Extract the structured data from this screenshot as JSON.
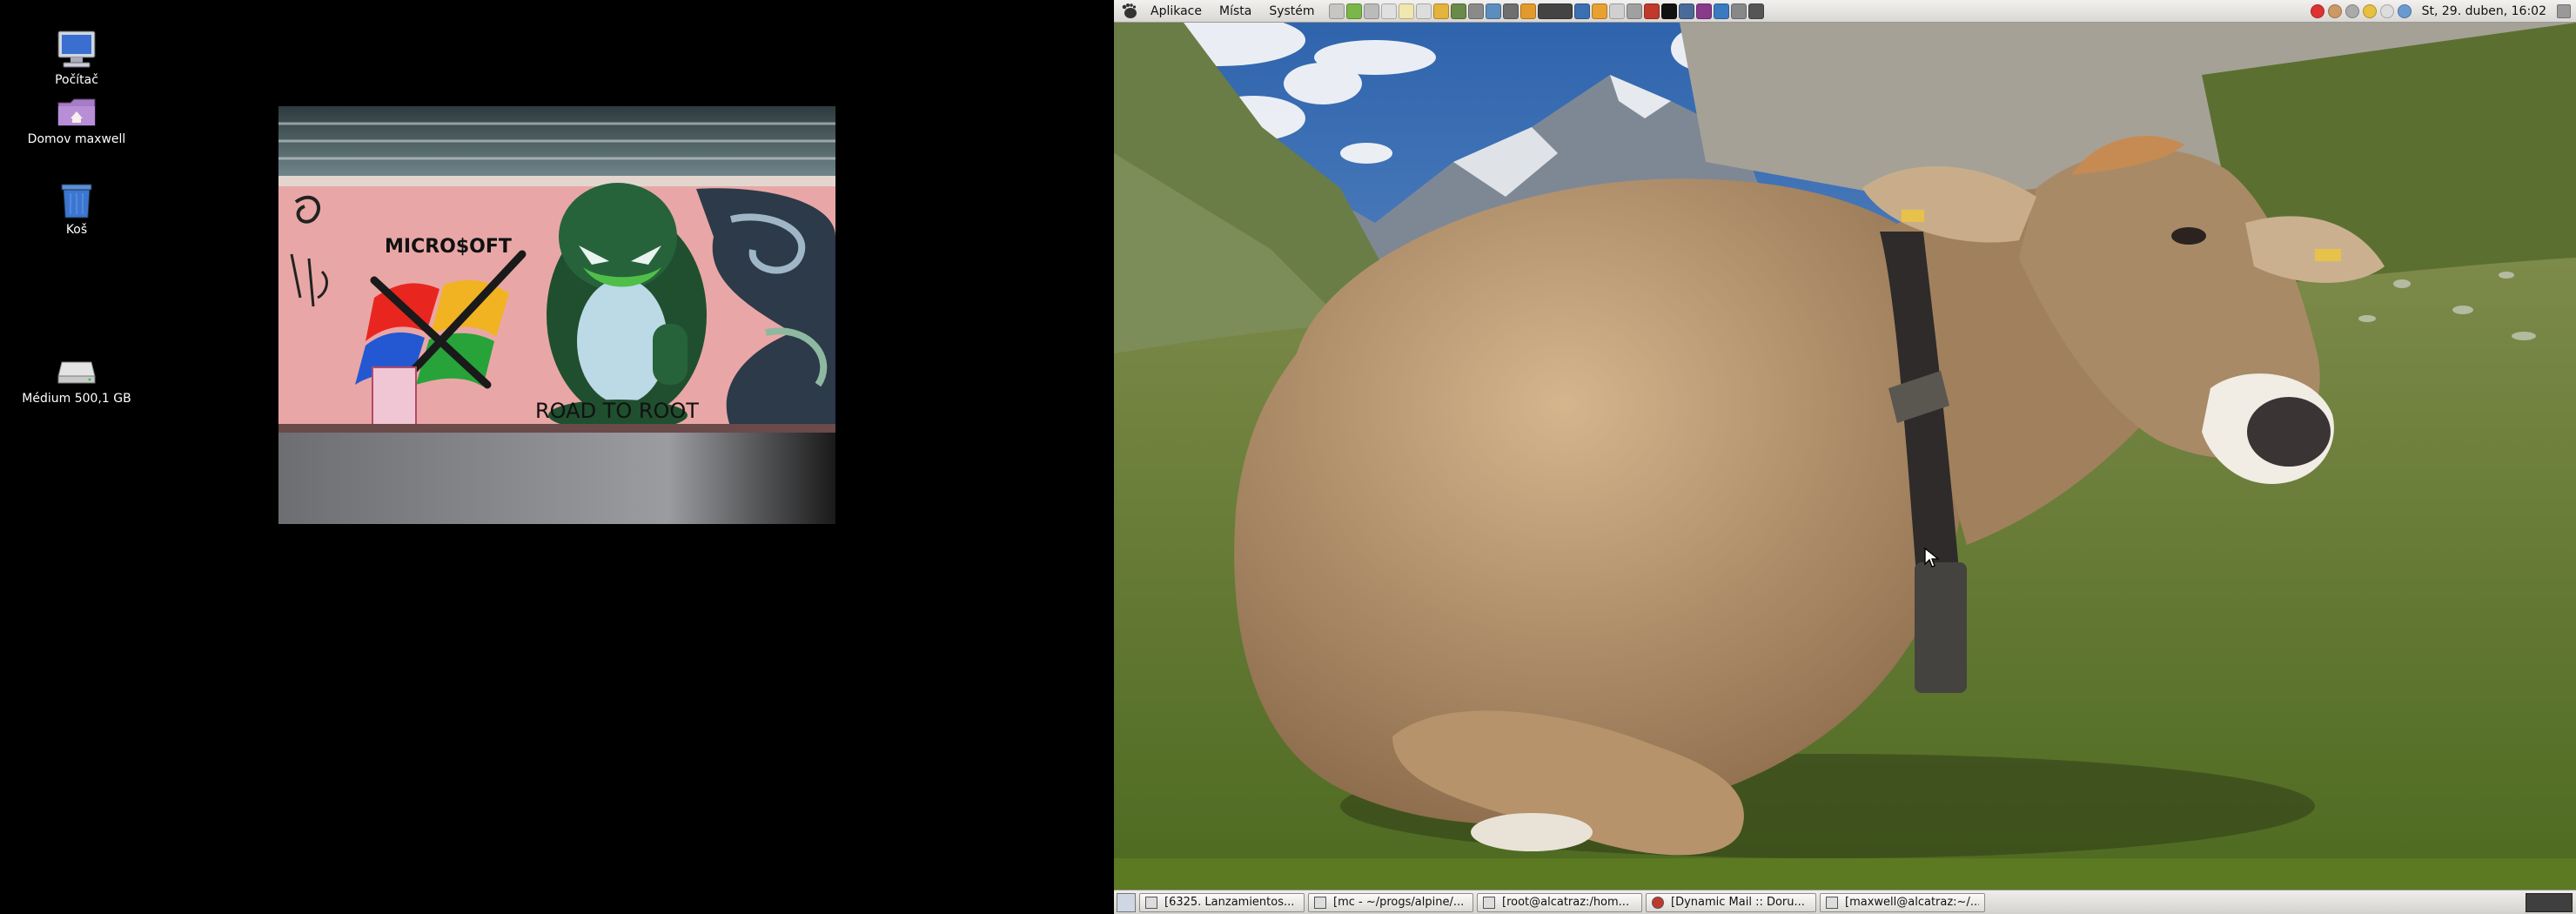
{
  "desktop": {
    "icons": [
      {
        "label": "Počítač",
        "icon": "computer-icon"
      },
      {
        "label": "Domov maxwell",
        "icon": "home-folder-icon"
      },
      {
        "label": "Koš",
        "icon": "trash-icon"
      },
      {
        "label": "Médium 500,1 GB",
        "icon": "hard-drive-icon"
      }
    ],
    "graffiti_text": {
      "brand": "MICRO$OFT",
      "tag": "ROAD TO ROOT"
    }
  },
  "top_panel": {
    "menus": [
      "Aplikace",
      "Místa",
      "Systém"
    ],
    "clock": "St, 29. duben, 16:02"
  },
  "taskbar": {
    "tasks": [
      {
        "label": "[6325. Lanzamientos..."
      },
      {
        "label": "[mc - ~/progs/alpine/..."
      },
      {
        "label": "[root@alcatraz:/hom..."
      },
      {
        "label": "[Dynamic Mail :: Doru..."
      },
      {
        "label": "[maxwell@alcatraz:~/..."
      }
    ]
  },
  "colors": {
    "panel": "#e6e4e0",
    "desktop_bg": "#000000",
    "sky": "#3a6fb0",
    "grass": "#5d7a2c"
  }
}
